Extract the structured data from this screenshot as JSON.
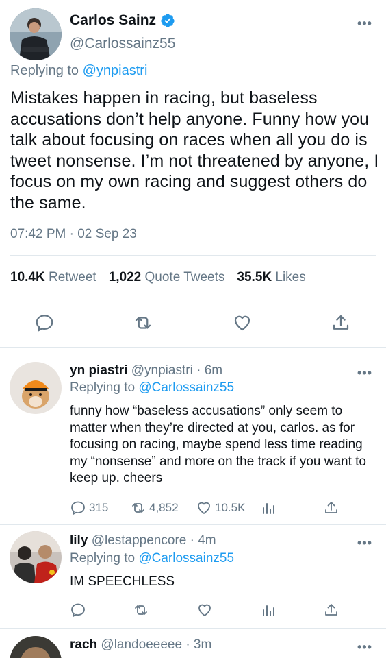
{
  "main_tweet": {
    "author_name": "Carlos Sainz",
    "author_handle": "@Carlossainz55",
    "replying_prefix": "Replying to",
    "replying_to": "@ynpiastri",
    "text": "Mistakes happen in racing, but baseless accusations don’t help anyone. Funny how you talk about focusing on races when all you do is tweet nonsense. I’m not threatened by anyone, I focus on my own racing and suggest others do the same.",
    "timestamp": "07:42 PM · 02 Sep 23",
    "retweets_count": "10.4K",
    "retweets_label": "Retweet",
    "quotes_count": "1,022",
    "quotes_label": "Quote Tweets",
    "likes_count": "35.5K",
    "likes_label": "Likes"
  },
  "replies": [
    {
      "name": "yn piastri",
      "handle": "@ynpiastri",
      "time": "· 6m",
      "replying_prefix": "Replying to",
      "replying_to": "@Carlossainz55",
      "text": "funny how “baseless accusations” only seem to matter when they’re directed at you, carlos. as for focusing on racing, maybe spend less time reading my “nonsense” and more on the track if you want to keep up. cheers",
      "replies_count": "315",
      "retweets_count": "4,852",
      "likes_count": "10.5K"
    },
    {
      "name": "lily",
      "handle": "@lestappencore",
      "time": "· 4m",
      "replying_prefix": "Replying to",
      "replying_to": "@Carlossainz55",
      "text": "IM SPEECHLESS"
    },
    {
      "name": "rach",
      "handle": "@landoeeeee",
      "time": "· 3m"
    }
  ],
  "colors": {
    "accent": "#1d9bf0",
    "secondary_text": "#657786",
    "divider": "#e1e8ed"
  },
  "icons": [
    "verified-badge-icon",
    "more-icon",
    "reply-icon",
    "retweet-icon",
    "like-icon",
    "share-icon",
    "analytics-icon"
  ]
}
